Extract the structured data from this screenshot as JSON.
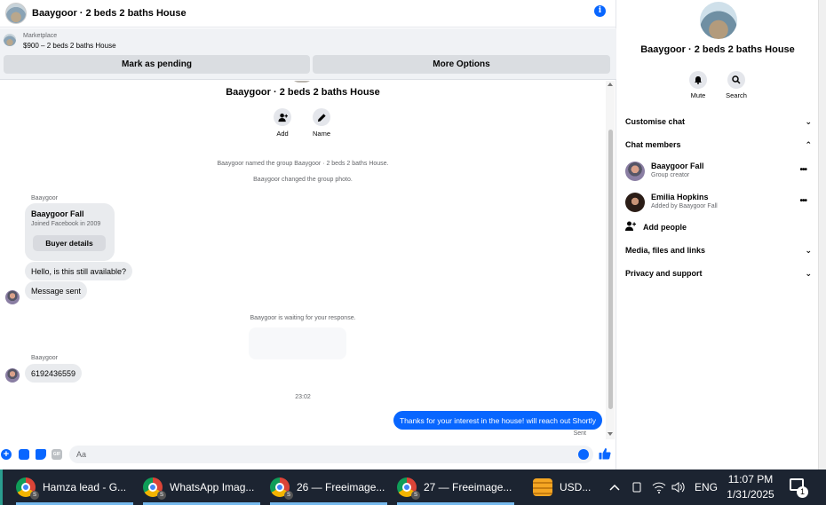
{
  "chat": {
    "title": "Baaygoor · 2 beds 2 baths House",
    "marketplace_label": "Marketplace",
    "listing": "$900 – 2 beds 2 baths House",
    "mark_pending": "Mark as pending",
    "more_options": "More Options",
    "group_name": "Baaygoor · 2 beds 2 baths House",
    "actions": [
      {
        "label": "Add"
      },
      {
        "label": "Name"
      }
    ],
    "system_messages": [
      "Baaygoor named the group Baaygoor · 2 beds 2 baths House.",
      "Baaygoor changed the group photo.",
      "Baaygoor is waiting for your response."
    ],
    "sender": "Baaygoor",
    "card": {
      "title": "Baaygoor Fall",
      "subtitle": "Joined Facebook in 2009",
      "button": "Buyer details"
    },
    "incoming": [
      "Hello, is this still available?",
      "Message sent",
      "6192436559"
    ],
    "time": "23:02",
    "outgoing": "Thanks for your interest in the house! will reach out Shortly",
    "sent_status": "Sent",
    "composer_placeholder": "Aa",
    "gif_label": "GIF"
  },
  "panel": {
    "title": "Baaygoor · 2 beds 2 baths House",
    "actions": [
      {
        "label": "Mute",
        "icon": "bell-icon"
      },
      {
        "label": "Search",
        "icon": "search-icon"
      }
    ],
    "sections": {
      "customise": "Customise chat",
      "members": "Chat members",
      "media": "Media, files and links",
      "privacy": "Privacy and support"
    },
    "members": [
      {
        "name": "Baaygoor Fall",
        "role": "Group creator"
      },
      {
        "name": "Emilia Hopkins",
        "role": "Added by Baaygoor Fall"
      }
    ],
    "add_people": "Add people"
  },
  "taskbar": {
    "items": [
      {
        "label": "Hamza lead - G...",
        "icon": "chrome-icon"
      },
      {
        "label": "WhatsApp Imag...",
        "icon": "chrome-icon"
      },
      {
        "label": "26 — Freeimage...",
        "icon": "chrome-icon"
      },
      {
        "label": "27 — Freeimage...",
        "icon": "chrome-icon"
      },
      {
        "label": "USD...",
        "icon": "currency-icon"
      }
    ],
    "profile_badge": "S",
    "language": "ENG",
    "time": "11:07 PM",
    "date": "1/31/2025",
    "notification_count": "1"
  },
  "colors": {
    "accent": "#0866ff",
    "taskbar": "#1c2431"
  }
}
